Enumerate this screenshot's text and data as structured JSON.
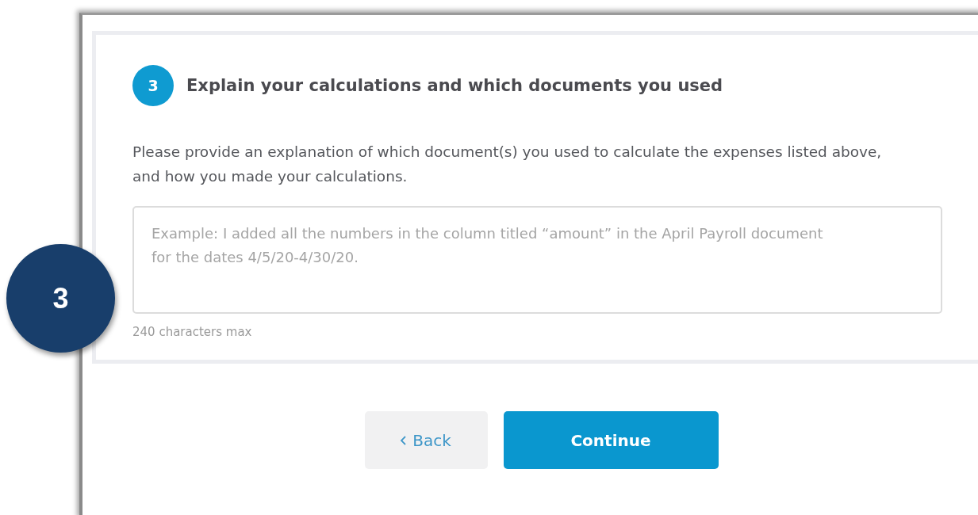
{
  "callout": {
    "label": "3"
  },
  "section": {
    "step": "3",
    "title": "Explain your calculations and which documents you used",
    "description": "Please provide an explanation of which document(s) you used to calculate the expenses listed above, and how you made your calculations.",
    "field": {
      "placeholder": "Example: I added all the numbers in the column titled “amount” in the April Payroll document for the dates 4/5/20-4/30/20."
    },
    "hint": "240 characters max"
  },
  "buttons": [
    {
      "kind": "back",
      "label": "Back"
    },
    {
      "kind": "primary",
      "label": "Continue"
    }
  ]
}
